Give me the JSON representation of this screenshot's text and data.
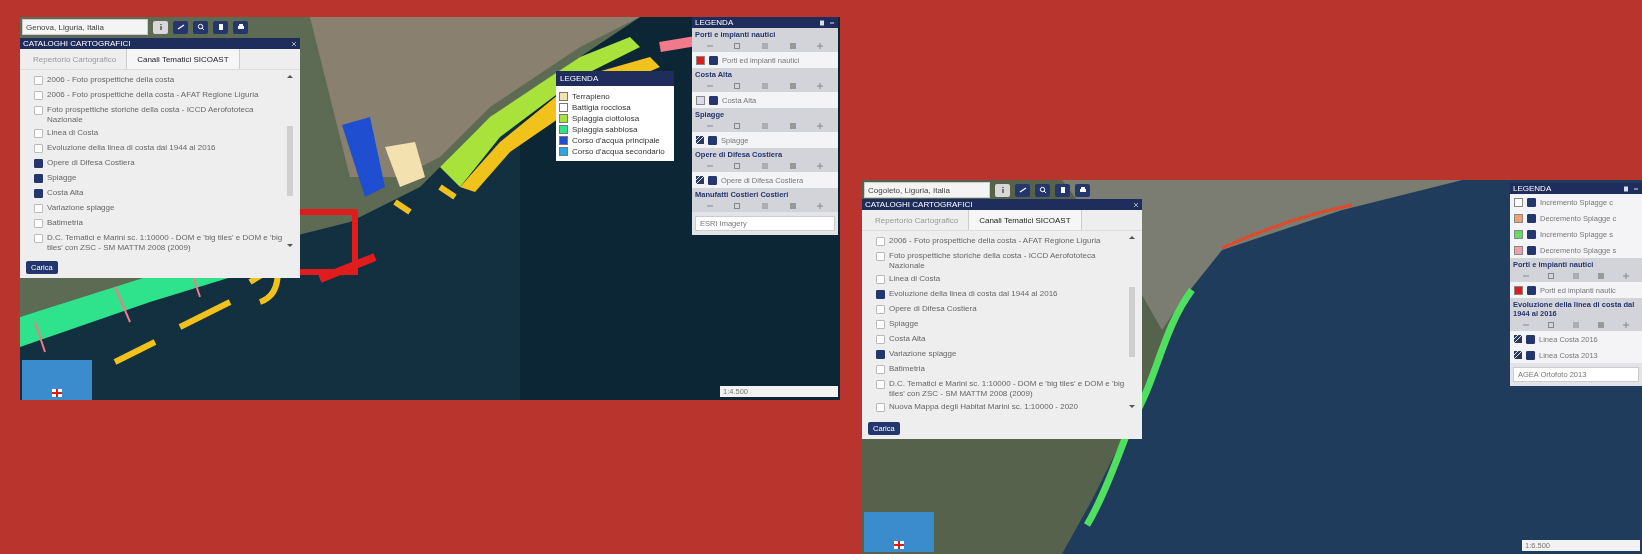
{
  "screens": [
    {
      "map": {
        "kind": "harbor"
      },
      "search": {
        "value": "Genova, Liguria, Italia"
      },
      "catalog": {
        "title": "CATALOGHI CARTOGRAFICI",
        "tabs": [
          {
            "label": "Repertorio Cartografico",
            "selected": false
          },
          {
            "label": "Canali Tematici SICOAST",
            "selected": true
          }
        ],
        "items": [
          {
            "label": "2006 - Foto prospettiche della costa",
            "checked": false
          },
          {
            "label": "2006 - Foto prospettiche della costa - AFAT Regione Liguria",
            "checked": false
          },
          {
            "label": "Foto prospettiche storiche della costa - ICCD Aerofototeca Nazionale",
            "checked": false
          },
          {
            "label": "Linea di Costa",
            "checked": false
          },
          {
            "label": "Evoluzione della linea di costa dal 1944 al 2016",
            "checked": false
          },
          {
            "label": "Opere di Difesa Costiera",
            "checked": true
          },
          {
            "label": "Spiagge",
            "checked": true
          },
          {
            "label": "Costa Alta",
            "checked": true
          },
          {
            "label": "Variazione spiagge",
            "checked": false
          },
          {
            "label": "Batimetria",
            "checked": false
          },
          {
            "label": "D.C. Tematici e Marini sc. 1:10000 - DOM e 'big tiles' e DOM e 'big tiles' con ZSC - SM MATTM 2008 (2009)",
            "checked": false
          }
        ],
        "load_button": "Carica"
      },
      "map_legend": {
        "title": "LEGENDA",
        "items": [
          {
            "label": "Terrapieno",
            "color": "#f3e2b0"
          },
          {
            "label": "Battigia rocciosa",
            "color": "#ffffff"
          },
          {
            "label": "Spiaggia ciottolosa",
            "color": "#a8e23a"
          },
          {
            "label": "Spiaggia sabbiosa",
            "color": "#2fe38c"
          },
          {
            "label": "Corso d'acqua principale",
            "color": "#1f4fd0"
          },
          {
            "label": "Corso d'acqua secondario",
            "color": "#2aa6e6"
          }
        ]
      },
      "legend": {
        "title": "LEGENDA",
        "groups": [
          {
            "title": "Porti e impianti nautici",
            "tools": true,
            "rows": [
              {
                "kind": "swatch",
                "color": "#e01c1c",
                "label": "Porti ed impianti nautici",
                "checked": true
              }
            ]
          },
          {
            "title": "Costa Alta",
            "tools": true,
            "rows": [
              {
                "kind": "swatch",
                "color": "#dcdcec",
                "label": "Costa Alta",
                "checked": true
              }
            ]
          },
          {
            "title": "Spiagge",
            "tools": true,
            "rows": [
              {
                "kind": "pattern",
                "label": "Spiagge",
                "checked": true
              }
            ]
          },
          {
            "title": "Opere di Difesa Costiera",
            "tools": true,
            "rows": [
              {
                "kind": "pattern",
                "label": "Opere di Difesa Costiera",
                "checked": true
              }
            ]
          },
          {
            "title": "Manufatti Costieri Costieri",
            "tools": true
          }
        ],
        "base_layer": "ESRI Imagery"
      },
      "scale": "1:4.500"
    },
    {
      "map": {
        "kind": "coast"
      },
      "search": {
        "value": "Cogoleto, Liguria, Italia"
      },
      "catalog": {
        "title": "CATALOGHI CARTOGRAFICI",
        "tabs": [
          {
            "label": "Repertorio Cartografico",
            "selected": false
          },
          {
            "label": "Canali Tematici SICOAST",
            "selected": true
          }
        ],
        "items": [
          {
            "label": "2006 - Foto prospettiche della costa - AFAT Regione Liguria",
            "checked": false
          },
          {
            "label": "Foto prospettiche storiche della costa - ICCD Aerofototeca Nazionale",
            "checked": false
          },
          {
            "label": "Linea di Costa",
            "checked": false
          },
          {
            "label": "Evoluzione della linea di costa dal 1944 al 2016",
            "checked": true
          },
          {
            "label": "Opere di Difesa Costiera",
            "checked": false
          },
          {
            "label": "Spiagge",
            "checked": false
          },
          {
            "label": "Costa Alta",
            "checked": false
          },
          {
            "label": "Variazione spiagge",
            "checked": true
          },
          {
            "label": "Batimetria",
            "checked": false
          },
          {
            "label": "D.C. Tematici e Marini sc. 1:10000 - DOM e 'big tiles' e DOM e 'big tiles' con ZSC - SM MATTM 2008 (2009)",
            "checked": false
          },
          {
            "label": "Nuova Mappa degli Habitat Marini sc. 1:10000 - 2020",
            "checked": false
          }
        ],
        "load_button": "Carica"
      },
      "legend": {
        "title": "LEGENDA",
        "groups": [
          {
            "rows": [
              {
                "kind": "swatch",
                "color": "#ffffff",
                "label": "Incremento Spiagge c",
                "checked": true
              },
              {
                "kind": "swatch",
                "color": "#f0a070",
                "label": "Decremento Spiagge c",
                "checked": true
              },
              {
                "kind": "swatch",
                "color": "#5ee05e",
                "label": "Incremento Spiagge s",
                "checked": true
              },
              {
                "kind": "swatch",
                "color": "#f2a0a8",
                "label": "Decremento Spiagge s",
                "checked": true
              }
            ]
          },
          {
            "title": "Porti e impianti nautici",
            "tools": true,
            "rows": [
              {
                "kind": "swatch",
                "color": "#e01c1c",
                "label": "Porti ed impianti nautic",
                "checked": true
              }
            ]
          },
          {
            "title": "Evoluzione della linea di costa dal 1944 al 2016",
            "tools": true,
            "rows": [
              {
                "kind": "pattern",
                "label": "Linea Costa 2016",
                "checked": true
              },
              {
                "kind": "pattern",
                "label": "Linea Costa 2013",
                "checked": true
              }
            ]
          }
        ],
        "base_layer": "AGEA Ortofoto 2013"
      },
      "scale": "1:6.500"
    }
  ]
}
